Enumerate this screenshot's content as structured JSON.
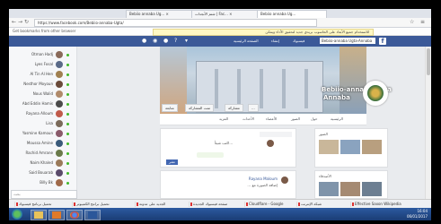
{
  "browser": {
    "tabs": [
      {
        "label": "Bebiio annaba Ug... ×"
      },
      {
        "label": "شتم الأنجدات | Fac... ×"
      },
      {
        "label": "Bebiio annaba Ug..."
      }
    ],
    "url": "https://www.facebook.com/Bebiio-annaba-Ugta/",
    "bookmarks": "Get bookmarks from other browser",
    "notice": "للاستخدام جميع الأبعاد على الحاسوب بريدي جديد لتحقيق الأداء ويمكن"
  },
  "facebook": {
    "search_value": "Bebiio-annaba Ugta-Annaba",
    "nav_home": "الصفحة الرئيسية",
    "nav_create": "إنشاء",
    "nav_profile": "فيسبوك"
  },
  "chat": {
    "contacts": [
      "Otman Hadj",
      "Lyes Fosal",
      "Al Tin Al Hen",
      "Nesthor Moyoun",
      "Nous Walid",
      "Abd Eddin Hamis",
      "Rayana Alloum",
      "Lisa",
      "Yasmine Kamoun",
      "Moussa Amine",
      "Rachid Amrane",
      "Naim Khaled",
      "Said Bouarab",
      "Billy Bk"
    ],
    "search_placeholder": "بحث"
  },
  "page": {
    "title": "Bebiio-annaba Ugta",
    "subtitle": "Annaba",
    "cover_buttons": [
      "متابعة",
      "تمت المشاركة",
      "مشاركة",
      "...",
      "المزيد"
    ],
    "tabs": [
      "الرئيسية",
      "حول",
      "الصور",
      "الأعضاء",
      "الأحداث",
      "المزيد"
    ],
    "composer_prompt": "اكتب شيئاً...",
    "post_button": "نشر",
    "post_author": "Rayana Maloum",
    "post_text": "... إضافة الصورة مع",
    "right_cards": [
      {
        "label": "الصور"
      },
      {
        "label": "الأصدقاء"
      }
    ]
  },
  "taskbar": {
    "items": [
      "تحميل برنامج فيسبوك",
      "تحميل برامج الكمبيوتر",
      "الجديد على مدونة",
      "صفحة فيسبوك الجديدة",
      "Cloudflare - Google",
      "شبكة الإنترنت",
      "Effective Saxon Wikipedia"
    ],
    "clock_time": "16:04",
    "clock_date": "06/01/2017"
  },
  "colors": {
    "facebook_blue": "#3b5998",
    "taskbar": "#1f3e6b"
  }
}
